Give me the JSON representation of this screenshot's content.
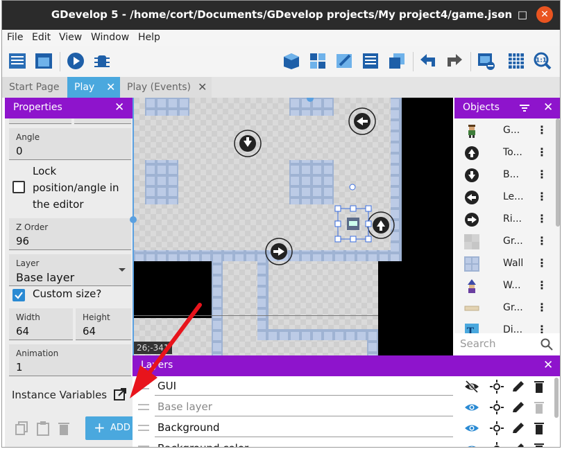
{
  "window": {
    "title": "GDevelop 5 - /home/cort/Documents/GDevelop projects/My project4/game.json",
    "minimize": "–",
    "maximize": "□",
    "close": "✕"
  },
  "menu": [
    "File",
    "Edit",
    "View",
    "Window",
    "Help"
  ],
  "tabs": [
    {
      "label": "Start Page"
    },
    {
      "label": "Play",
      "close": "✕"
    },
    {
      "label": "Play (Events)",
      "close": "✕"
    }
  ],
  "properties": {
    "title": "Properties",
    "close": "✕",
    "angle": {
      "label": "Angle",
      "value": "0"
    },
    "lock": {
      "label": [
        "Lock",
        "position/angle in",
        "the editor"
      ],
      "checked": false
    },
    "z_order": {
      "label": "Z Order",
      "value": "96"
    },
    "layer": {
      "label": "Layer",
      "value": "Base layer"
    },
    "custom_size": {
      "label": "Custom size?",
      "checked": true
    },
    "width": {
      "label": "Width",
      "value": "64"
    },
    "height": {
      "label": "Height",
      "value": "64"
    },
    "animation": {
      "label": "Animation",
      "value": "1"
    },
    "instance_variables": "Instance Variables",
    "add_label": "ADD"
  },
  "canvas": {
    "coords": "26;-341"
  },
  "objects": {
    "title": "Objects",
    "close": "✕",
    "items": [
      {
        "name": "G...",
        "icon": "player-sprite-icon"
      },
      {
        "name": "To...",
        "icon": "arrow-up-icon"
      },
      {
        "name": "B...",
        "icon": "arrow-down-icon"
      },
      {
        "name": "Le...",
        "icon": "arrow-left-icon"
      },
      {
        "name": "Ri...",
        "icon": "arrow-right-icon"
      },
      {
        "name": "Gr...",
        "icon": "ground-tile-icon"
      },
      {
        "name": "Wall",
        "icon": "wall-tile-icon"
      },
      {
        "name": "W...",
        "icon": "wizard-sprite-icon"
      },
      {
        "name": "Gr...",
        "icon": "grass-tile-icon"
      },
      {
        "name": "Di...",
        "icon": "text-object-icon"
      }
    ],
    "search_placeholder": "Search"
  },
  "layers": {
    "title": "Layers",
    "close": "✕",
    "items": [
      {
        "name": "GUI",
        "visible": false
      },
      {
        "name": "Base layer",
        "visible": true
      },
      {
        "name": "Background",
        "visible": true
      },
      {
        "name": "Background color",
        "visible": true
      }
    ]
  },
  "colors": {
    "accent": "#8e14cc",
    "tab_active": "#4aa8de",
    "button": "#4aa8de",
    "annotation_arrow": "#e8141c"
  }
}
